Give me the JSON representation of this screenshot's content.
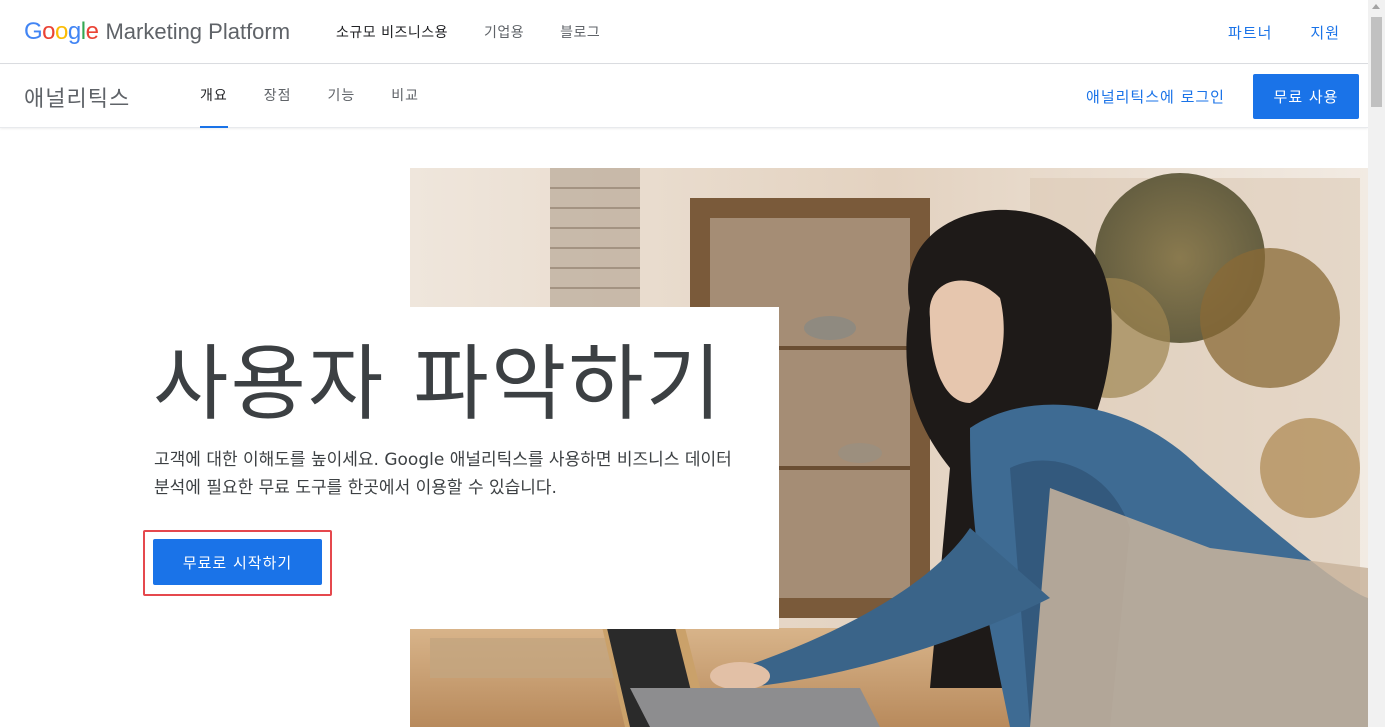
{
  "brand": {
    "logo_letters": [
      {
        "ch": "G",
        "color": "#4285f4"
      },
      {
        "ch": "o",
        "color": "#ea4335"
      },
      {
        "ch": "o",
        "color": "#fbbc05"
      },
      {
        "ch": "g",
        "color": "#4285f4"
      },
      {
        "ch": "l",
        "color": "#34a853"
      },
      {
        "ch": "e",
        "color": "#ea4335"
      }
    ],
    "platform_label": "Marketing Platform"
  },
  "top_nav": {
    "items": [
      {
        "label": "소규모 비즈니스용"
      },
      {
        "label": "기업용"
      },
      {
        "label": "블로그"
      }
    ],
    "right": [
      {
        "label": "파트너"
      },
      {
        "label": "지원"
      }
    ]
  },
  "product_bar": {
    "product_name": "애널리틱스",
    "tabs": [
      {
        "label": "개요",
        "active": true
      },
      {
        "label": "장점"
      },
      {
        "label": "기능"
      },
      {
        "label": "비교"
      }
    ],
    "login_label": "애널리틱스에 로그인",
    "free_button_label": "무료 사용"
  },
  "hero": {
    "title": "사용자 파악하기",
    "description": "고객에 대한 이해도를 높이세요. Google 애널리틱스를 사용하면 비즈니스 데이터 분석에 필요한 무료 도구를 한곳에서 이용할 수 있습니다.",
    "cta_label": "무료로 시작하기"
  },
  "colors": {
    "accent": "#1a73e8",
    "highlight_frame": "#e5484d"
  }
}
